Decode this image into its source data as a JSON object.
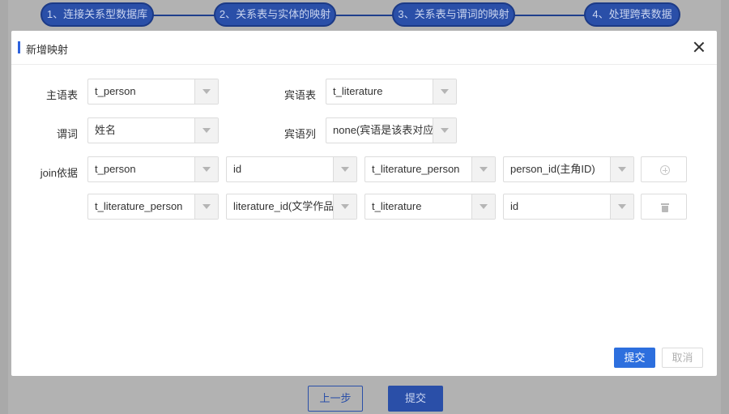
{
  "steps": [
    {
      "label": "1、连接关系型数据库"
    },
    {
      "label": "2、关系表与实体的映射"
    },
    {
      "label": "3、关系表与谓词的映射"
    },
    {
      "label": "4、处理跨表数据"
    }
  ],
  "page_buttons": {
    "prev": "上一步",
    "submit": "提交"
  },
  "modal": {
    "title": "新增映射",
    "subject_table_label": "主语表",
    "subject_table_value": "t_person",
    "object_table_label": "宾语表",
    "object_table_value": "t_literature",
    "predicate_label": "谓词",
    "predicate_value": "姓名",
    "object_column_label": "宾语列",
    "object_column_value": "none(宾语是该表对应的",
    "join_label": "join依据",
    "join_rows": [
      [
        "t_person",
        "id",
        "t_literature_person",
        "person_id(主角ID)"
      ],
      [
        "t_literature_person",
        "literature_id(文学作品ID)",
        "t_literature",
        "id"
      ]
    ],
    "submit": "提交",
    "cancel": "取消"
  },
  "icons": {
    "add": "plus-circle-icon",
    "delete": "trash-icon",
    "close": "close-icon"
  },
  "colors": {
    "primary": "#2d6fde",
    "overlay": "#a9a9a9"
  }
}
